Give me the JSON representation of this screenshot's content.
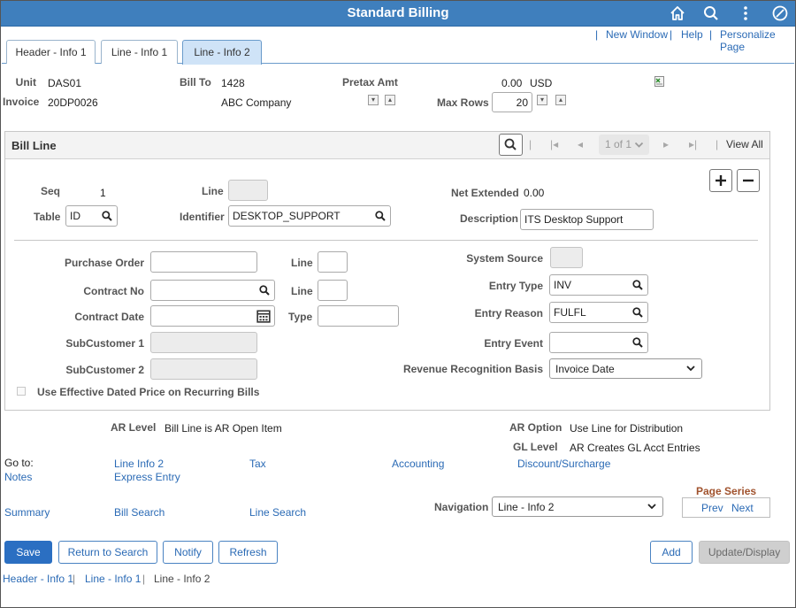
{
  "banner": {
    "title": "Standard Billing"
  },
  "top_links": {
    "new_window": "New Window",
    "help": "Help",
    "personalize": "Personalize Page",
    "separator": "|"
  },
  "tabs": [
    {
      "label": "Header - Info 1"
    },
    {
      "label": "Line - Info 1"
    },
    {
      "label": "Line - Info 2",
      "active": true
    }
  ],
  "header": {
    "unit_label": "Unit",
    "unit_value": "DAS01",
    "invoice_label": "Invoice",
    "invoice_value": "20DP0026",
    "bill_to_label": "Bill To",
    "bill_to_value": "1428",
    "bill_to_name": "ABC Company",
    "pretax_label": "Pretax Amt",
    "pretax_value": "0.00",
    "currency": "USD",
    "max_rows_label": "Max Rows",
    "max_rows_value": "20"
  },
  "bill_line": {
    "title": "Bill Line",
    "pager": "1 of 1",
    "view_all": "View All",
    "seq_label": "Seq",
    "seq_value": "1",
    "line_label": "Line",
    "line_value": "",
    "net_extended_label": "Net Extended",
    "net_extended_value": "0.00",
    "table_label": "Table",
    "table_value": "ID",
    "identifier_label": "Identifier",
    "identifier_value": "DESKTOP_SUPPORT",
    "description_label": "Description",
    "description_value": "ITS Desktop Support",
    "po_label": "Purchase Order",
    "po_value": "",
    "po_line_label": "Line",
    "po_line_value": "",
    "contract_no_label": "Contract No",
    "contract_no_value": "",
    "contract_line_label": "Line",
    "contract_line_value": "",
    "contract_date_label": "Contract Date",
    "contract_date_value": "",
    "type_label": "Type",
    "type_value": "",
    "subcust1_label": "SubCustomer 1",
    "subcust1_value": "",
    "subcust2_label": "SubCustomer 2",
    "subcust2_value": "",
    "system_source_label": "System Source",
    "system_source_value": "",
    "entry_type_label": "Entry Type",
    "entry_type_value": "INV",
    "entry_reason_label": "Entry Reason",
    "entry_reason_value": "FULFL",
    "entry_event_label": "Entry Event",
    "entry_event_value": "",
    "rev_rec_label": "Revenue Recognition Basis",
    "rev_rec_value": "Invoice Date",
    "eff_dated_label": "Use Effective Dated Price on Recurring Bills"
  },
  "ar": {
    "ar_level_label": "AR Level",
    "ar_level_value": "Bill Line is AR Open Item",
    "ar_option_label": "AR Option",
    "ar_option_value": "Use Line for Distribution",
    "gl_level_label": "GL Level",
    "gl_level_value": "AR Creates GL Acct Entries"
  },
  "goto": {
    "label": "Go to:",
    "links": [
      "Line Info 2",
      "Tax",
      "Accounting",
      "Discount/Surcharge",
      "Notes",
      "Express Entry",
      "Summary",
      "Bill Search",
      "Line Search"
    ]
  },
  "navigation": {
    "label": "Navigation",
    "value": "Line - Info 2"
  },
  "page_series": {
    "title": "Page Series",
    "prev": "Prev",
    "next": "Next"
  },
  "buttons": {
    "save": "Save",
    "return": "Return to Search",
    "notify": "Notify",
    "refresh": "Refresh",
    "add": "Add",
    "update": "Update/Display"
  },
  "footer_links": {
    "header": "Header - Info 1",
    "line1": "Line - Info 1",
    "line2": "Line - Info 2",
    "sep": "|"
  },
  "colors": {
    "banner": "#3f7fbd",
    "link": "#2a6ab5",
    "primary_button": "#2b6fc2",
    "active_tab": "#cfe3f7"
  }
}
